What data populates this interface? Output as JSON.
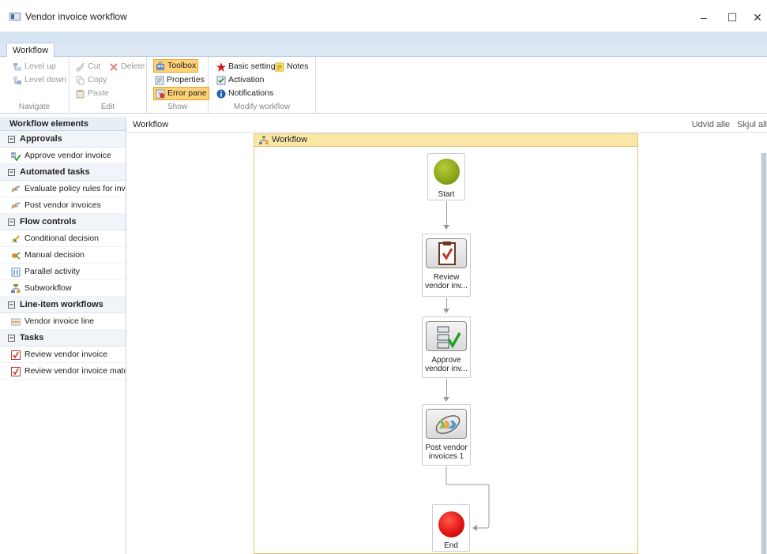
{
  "window": {
    "title": "Vendor invoice workflow",
    "minimize": "–",
    "maximize": "☐",
    "close": "✕"
  },
  "ribbon": {
    "tab": "Workflow",
    "groups": {
      "navigate": {
        "label": "Navigate",
        "level_up": "Level up",
        "level_down": "Level down"
      },
      "edit": {
        "label": "Edit",
        "cut": "Cut",
        "delete": "Delete",
        "copy": "Copy",
        "paste": "Paste"
      },
      "show": {
        "label": "Show",
        "toolbox": "Toolbox",
        "properties": "Properties",
        "error_pane": "Error pane"
      },
      "modify": {
        "label": "Modify workflow",
        "basic_settings": "Basic settings",
        "notes": "Notes",
        "activation": "Activation",
        "notifications": "Notifications"
      }
    }
  },
  "toolbox": {
    "header": "Workflow elements",
    "categories": [
      {
        "label": "Approvals",
        "items": [
          "Approve vendor invoice"
        ]
      },
      {
        "label": "Automated tasks",
        "items": [
          "Evaluate policy rules for invoic",
          "Post vendor invoices"
        ]
      },
      {
        "label": "Flow controls",
        "items": [
          "Conditional decision",
          "Manual decision",
          "Parallel activity",
          "Subworkflow"
        ]
      },
      {
        "label": "Line-item workflows",
        "items": [
          "Vendor invoice line"
        ]
      },
      {
        "label": "Tasks",
        "items": [
          "Review vendor invoice",
          "Review vendor invoice matchir"
        ]
      }
    ],
    "collapse_glyph": "−"
  },
  "canvas": {
    "title": "Workflow",
    "expand_all": "Udvid alle",
    "hide_all": "Skjul all",
    "frame_title": "Workflow",
    "nodes": {
      "start": "Start",
      "review_l1": "Review",
      "review_l2": "vendor inv...",
      "approve_l1": "Approve",
      "approve_l2": "vendor inv...",
      "post_l1": "Post vendor",
      "post_l2": "invoices 1",
      "end": "End"
    }
  },
  "colors": {
    "start_green": "#8aa41a",
    "end_red": "#e01010",
    "frame_header": "#fbe7a5",
    "active_button": "#ffd278"
  }
}
